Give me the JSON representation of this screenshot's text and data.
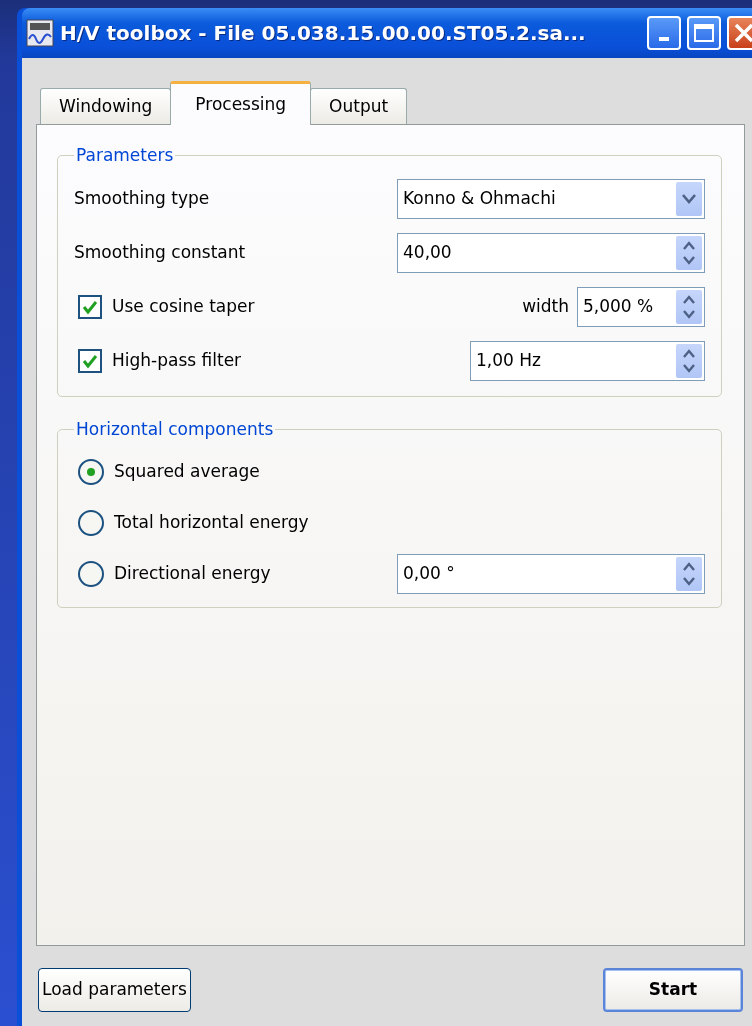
{
  "window": {
    "title": "H/V toolbox - File 05.038.15.00.00.ST05.2.sa..."
  },
  "tabs": [
    {
      "label": "Windowing",
      "selected": false
    },
    {
      "label": "Processing",
      "selected": true
    },
    {
      "label": "Output",
      "selected": false
    }
  ],
  "parameters": {
    "title": "Parameters",
    "rows": [
      {
        "kind": "combo",
        "label": "Smoothing type",
        "value": "Konno & Ohmachi"
      },
      {
        "kind": "spin",
        "label": "Smoothing constant",
        "value": "40,00"
      },
      {
        "kind": "check",
        "label": "Use cosine taper",
        "checked": true,
        "field_label": "width",
        "value": "5,000 %"
      },
      {
        "kind": "check",
        "label": "High-pass filter",
        "checked": true,
        "value": "1,00 Hz"
      }
    ]
  },
  "horizontal_components": {
    "title": "Horizontal components",
    "options": [
      {
        "label": "Squared average",
        "selected": true
      },
      {
        "label": "Total horizontal energy",
        "selected": false
      },
      {
        "label": "Directional energy",
        "selected": false,
        "value": "0,00 °"
      }
    ]
  },
  "buttons": [
    {
      "label": "Load parameters",
      "default": false
    },
    {
      "label": "Start",
      "default": true
    }
  ]
}
